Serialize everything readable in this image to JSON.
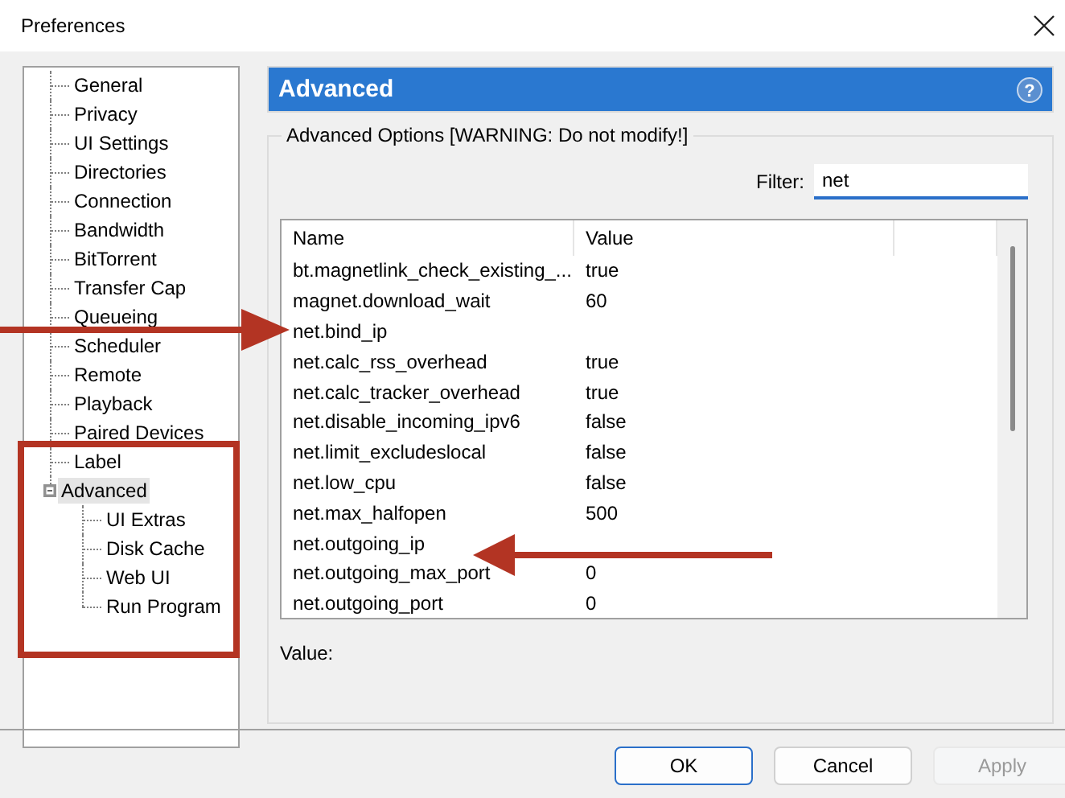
{
  "window": {
    "title": "Preferences"
  },
  "tree": [
    {
      "label": "General",
      "selected": false
    },
    {
      "label": "Privacy",
      "selected": false
    },
    {
      "label": "UI Settings",
      "selected": false
    },
    {
      "label": "Directories",
      "selected": false
    },
    {
      "label": "Connection",
      "selected": false
    },
    {
      "label": "Bandwidth",
      "selected": false
    },
    {
      "label": "BitTorrent",
      "selected": false
    },
    {
      "label": "Transfer Cap",
      "selected": false
    },
    {
      "label": "Queueing",
      "selected": false
    },
    {
      "label": "Scheduler",
      "selected": false
    },
    {
      "label": "Remote",
      "selected": false
    },
    {
      "label": "Playback",
      "selected": false
    },
    {
      "label": "Paired Devices",
      "selected": false
    },
    {
      "label": "Label",
      "selected": false
    },
    {
      "label": "Advanced",
      "selected": true,
      "expanded": true,
      "children": [
        {
          "label": "UI Extras",
          "selected": false
        },
        {
          "label": "Disk Cache",
          "selected": false
        },
        {
          "label": "Web UI",
          "selected": false
        },
        {
          "label": "Run Program",
          "selected": false
        }
      ]
    }
  ],
  "panel": {
    "title": "Advanced",
    "help": "?",
    "group_title": "Advanced Options [WARNING: Do not modify!]",
    "filter": {
      "label": "Filter:",
      "value": "net"
    },
    "table": {
      "columns": [
        "Name",
        "Value"
      ],
      "rows": [
        {
          "name": "bt.magnetlink_check_existing_...",
          "value": "true"
        },
        {
          "name": "magnet.download_wait",
          "value": "60"
        },
        {
          "name": "net.bind_ip"
        },
        {
          "name": "net.calc_rss_overhead",
          "value": "true"
        },
        {
          "name": "net.calc_tracker_overhead",
          "value": "true"
        },
        {
          "name": "net.disable_incoming_ipv6",
          "value": "false"
        },
        {
          "name": "net.limit_excludeslocal",
          "value": "false"
        },
        {
          "name": "net.low_cpu",
          "value": "false"
        },
        {
          "name": "net.max_halfopen",
          "value": "500"
        },
        {
          "name": "net.outgoing_ip"
        },
        {
          "name": "net.outgoing_max_port",
          "value": "0"
        },
        {
          "name": "net.outgoing_port",
          "value": "0"
        }
      ]
    },
    "value_label": "Value:"
  },
  "buttons": [
    {
      "label": "OK",
      "kind": "default",
      "disabled": false
    },
    {
      "label": "Cancel",
      "kind": "normal",
      "disabled": false
    },
    {
      "label": "Apply",
      "kind": "normal",
      "disabled": true
    }
  ],
  "annotations": [
    {
      "kind": "arrow"
    },
    {
      "kind": "arrow"
    },
    {
      "kind": "frame"
    }
  ]
}
